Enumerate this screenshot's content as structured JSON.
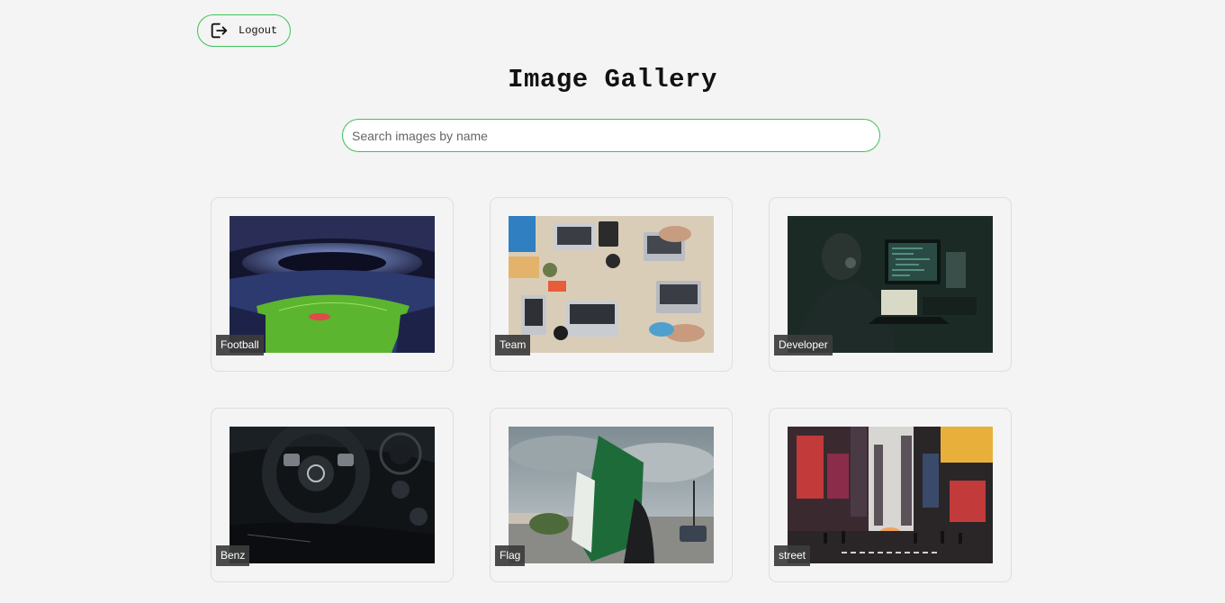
{
  "header": {
    "logout_label": "Logout",
    "logout_icon": "logout-icon"
  },
  "page": {
    "title": "Image Gallery"
  },
  "search": {
    "placeholder": "Search images by name",
    "value": ""
  },
  "gallery": {
    "items": [
      {
        "label": "Football"
      },
      {
        "label": "Team"
      },
      {
        "label": "Developer"
      },
      {
        "label": "Benz"
      },
      {
        "label": "Flag"
      },
      {
        "label": "street"
      }
    ]
  },
  "colors": {
    "accent": "#3cc25a",
    "background": "#f4f4f4",
    "caption_bg": "#3c3c3c"
  }
}
